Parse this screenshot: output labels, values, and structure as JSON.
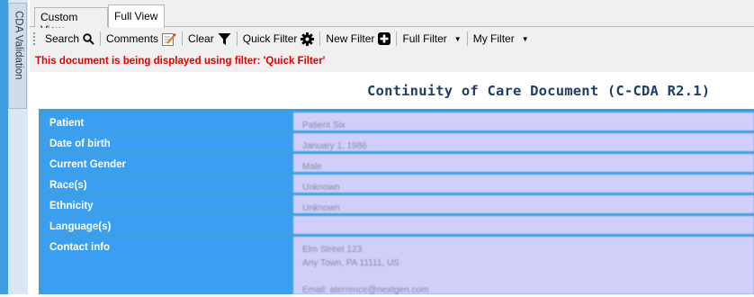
{
  "side_panel": {
    "label": "CDA Validation"
  },
  "tabs": [
    {
      "label": "Custom View",
      "active": false
    },
    {
      "label": "Full View",
      "active": true
    }
  ],
  "toolbar": {
    "search_label": "Search",
    "comments_label": "Comments",
    "clear_label": "Clear",
    "quick_filter_label": "Quick Filter",
    "new_filter_label": "New Filter",
    "full_filter_label": "Full Filter",
    "my_filter_label": "My Filter"
  },
  "filter_message": "This document is being displayed using filter: 'Quick Filter'",
  "document": {
    "title": "Continuity of Care Document (C-CDA R2.1)",
    "rows": [
      {
        "label": "Patient",
        "value": "Patient Six"
      },
      {
        "label": "Date of birth",
        "value": "January 1, 1986"
      },
      {
        "label": "Current Gender",
        "value": "Male"
      },
      {
        "label": "Race(s)",
        "value": "Unknown"
      },
      {
        "label": "Ethnicity",
        "value": "Unknown"
      },
      {
        "label": "Language(s)",
        "value": ""
      },
      {
        "label": "Contact info",
        "value_lines": [
          "Elm Street 123",
          "Any Town, PA 11111, US",
          "",
          "Email: aterrence@nextgen.com"
        ]
      }
    ]
  },
  "colors": {
    "label_bg": "#3a9ff0",
    "value_bg": "#cfcff9",
    "filter_message": "#e00000",
    "title": "#1f3f66"
  }
}
